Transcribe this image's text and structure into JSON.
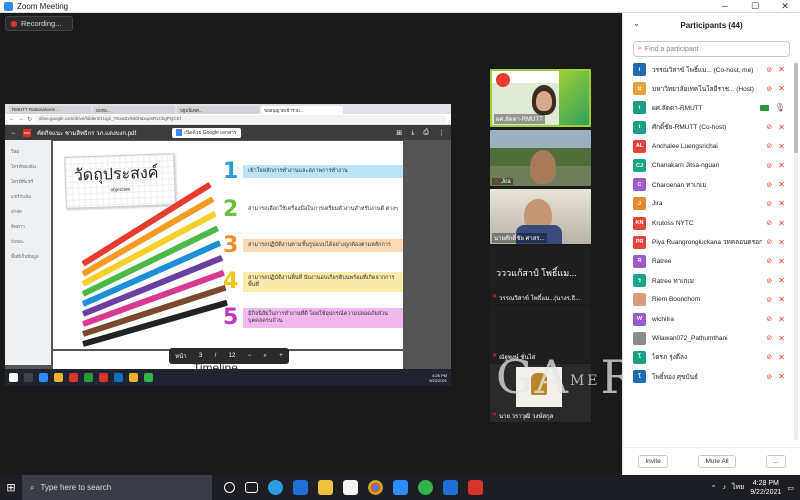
{
  "window": {
    "title": "Zoom Meeting",
    "minimize": "─",
    "maximize": "☐",
    "close": "✕"
  },
  "recording": {
    "label": "Recording..."
  },
  "shared_screen": {
    "browser_tabs": [
      "RMUTT Rattanakosin ...",
      "อบรม...",
      "ปฐมนิเทศ...",
      "ขออนุญาตเข้าร่วม..."
    ],
    "url": "drive.google.com/drive/folders/1Ugn_TKxw2xlNfdHaxupsR1CbgPQCKf",
    "file_name": "คัดกิจแนะ ชามสิทธิกร วภ.แดงบงก.pdf",
    "open_with": "เปิดด้วย Google เอกสาร",
    "left_pane": [
      "ใหม่",
      "ไดรฟ์ของฉัน",
      "ไดรฟ์ที่แชร์",
      "แชร์กับฉัน",
      "ล่าสุด",
      "ติดดาว",
      "ถังขยะ",
      "พื้นที่เก็บข้อมูล"
    ],
    "slide": {
      "title_th": "วัดถุประสงค์",
      "title_en": "objective",
      "items": [
        {
          "num": "1",
          "text": "เข้าใจหลักการทำงานและสภาพการทำงาน",
          "color": "#2a9fd6",
          "bg": "#bde4f5"
        },
        {
          "num": "2",
          "text": "สามารถเลือกใช้เครื่องมือในการเตรียมตัวงานสำหรับงานตี ต่างๆ",
          "color": "#6cbf3a",
          "bg": "#ffffff"
        },
        {
          "num": "3",
          "text": "สามารถปฏิบัติงานตามขั้นรูปแบบได้อย่างถูกต้องตามหลักการ",
          "color": "#f28c28",
          "bg": "#fbd9b5"
        },
        {
          "num": "4",
          "text": "สามารถปฏิบัติงานพื่นที่ นับงานอบเกียรติบนพร้อมที่เกิดจากการพื้นที่",
          "color": "#f2c418",
          "bg": "#fbeaa8"
        },
        {
          "num": "5",
          "text": "มีกิจนิสัยในการทำงานที่ดี โดยใช้อุปกรณ์ความปลอดภัยส่วนบุคคลครบถ้วน",
          "color": "#c535c0",
          "bg": "#f0b8ef"
        }
      ],
      "next_title": "Timeline"
    },
    "pdf_toolbar": {
      "page_label": "หน้า",
      "page": "3",
      "sep": "/",
      "total": "12"
    },
    "mini_clock": {
      "time": "4:26 PM",
      "date": "9/22/2021"
    }
  },
  "video_tiles": [
    {
      "name": "ผศ.ลัดดา-RMUTT",
      "muted": false
    },
    {
      "name": "Jira",
      "muted": true
    },
    {
      "name": "นายศักดิ์ชัย ศาสร...",
      "muted": false
    }
  ],
  "name_tiles": [
    {
      "big": "วววแก้สาป์ โพธิ์แม...",
      "name": "วรรณวิสาข์ โพธิ์แม...(นางร.ธิ...",
      "muted": true
    },
    {
      "big": "",
      "name": "ณัฐพงษ์ ชั่นไส",
      "muted": true
    },
    {
      "big": "",
      "name": "นาย วราวุฒิ วงษ์สกุล",
      "muted": true
    }
  ],
  "watermark": {
    "left": "GA",
    "small": "ME",
    "right": "R"
  },
  "participants": {
    "title": "Participants (44)",
    "search_placeholder": "Find a participant",
    "invite": "Invite",
    "mute_all": "Mute All",
    "more": "...",
    "list": [
      {
        "initials": "i",
        "name": "วรรณวิสาข์ โพธิ์แม... (Co-host, me)",
        "color": "#1f6bb0",
        "video": "off",
        "mic": "muted"
      },
      {
        "initials": "ม",
        "name": "มหาวิทยาลัยเทคโนโลยีราช... (Host)",
        "color": "#e5a13a",
        "video": "off",
        "mic": "muted"
      },
      {
        "initials": "i",
        "name": "ผศ.ลัดดา-RMUTT",
        "color": "#1a9f86",
        "video": "on",
        "mic": "on"
      },
      {
        "initials": "i",
        "name": "ศักดิ์ชัย-RMUTT (Co-host)",
        "color": "#1a9f86",
        "video": "off",
        "mic": "muted"
      },
      {
        "initials": "AL",
        "name": "Anchalee Luengsrichai",
        "color": "#e0463d",
        "video": "off",
        "mic": "muted"
      },
      {
        "initials": "CJ",
        "name": "Chanakarn Jitsa-nguan",
        "color": "#18a58c",
        "video": "off",
        "mic": "muted"
      },
      {
        "initials": "C",
        "name": "Charoenan ทาเกเม",
        "color": "#9b5cc9",
        "video": "off",
        "mic": "muted"
      },
      {
        "initials": "J",
        "name": "Jira",
        "color": "#e58a2a",
        "video": "off",
        "mic": "muted"
      },
      {
        "initials": "KN",
        "name": "Krutoss NYTC",
        "color": "#e0463d",
        "video": "off",
        "mic": "muted"
      },
      {
        "initials": "PR",
        "name": "Piya Ruangrongluckana วทคลอนตรอก",
        "color": "#e0463d",
        "video": "off",
        "mic": "muted"
      },
      {
        "initials": "R",
        "name": "Ratree",
        "color": "#9b5cc9",
        "video": "off",
        "mic": "muted"
      },
      {
        "initials": "ร",
        "name": "Ratree ทาเกเม",
        "color": "#18a58c",
        "video": "off",
        "mic": "muted"
      },
      {
        "initials": "",
        "name": "Riem Boonchom",
        "color": "#d79b7d",
        "video": "off",
        "mic": "muted"
      },
      {
        "initials": "W",
        "name": "wichitra",
        "color": "#9b5cc9",
        "video": "off",
        "mic": "muted"
      },
      {
        "initials": "",
        "name": "Wilawan072_Pathumthani",
        "color": "#8c8c8c",
        "video": "off",
        "mic": "muted"
      },
      {
        "initials": "โ",
        "name": "ไตรภ รุ่งดีลง",
        "color": "#1a9f86",
        "video": "off",
        "mic": "muted"
      },
      {
        "initials": "โ",
        "name": "โพธิ์ทอง ศุขบันธ์",
        "color": "#1f6bb0",
        "video": "off",
        "mic": "muted"
      }
    ]
  },
  "taskbar": {
    "search_placeholder": "Type here to search",
    "time": "4:28 PM",
    "date": "9/22/2021",
    "lang": "ไทย"
  }
}
